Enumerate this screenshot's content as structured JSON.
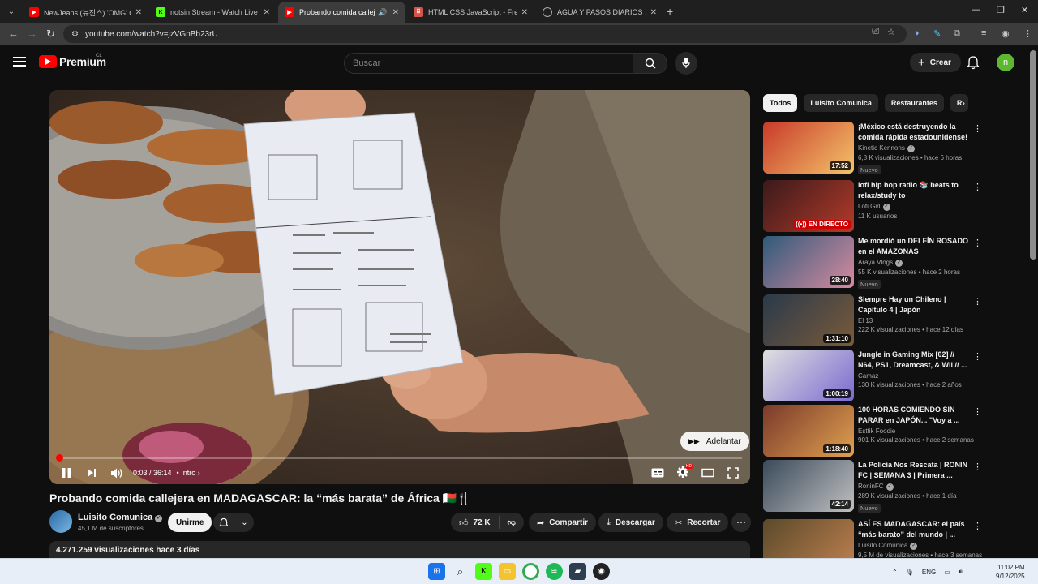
{
  "browser": {
    "tabs": [
      {
        "title": "NewJeans (뉴진스) 'OMG' Offic",
        "active": false,
        "favicon_color": "#ff0000"
      },
      {
        "title": "notsin Stream - Watch Live on",
        "active": false,
        "favicon_color": "#53fc18"
      },
      {
        "title": "Probando comida callejera",
        "active": true,
        "favicon_color": "#ff0000"
      },
      {
        "title": "HTML CSS JavaScript - Free Onl",
        "active": false,
        "favicon_color": "#d4534a"
      },
      {
        "title": "AGUA Y PASOS DIARIOS 💦🏃",
        "active": false,
        "favicon_color": "#aaaaaa"
      }
    ],
    "url": "youtube.com/watch?v=jzVGnBb23rU"
  },
  "header": {
    "logo_text": "Premium",
    "country": "CL",
    "search_placeholder": "Buscar",
    "create_label": "Crear",
    "avatar_letter": "n"
  },
  "player": {
    "skip_label": "Adelantar",
    "time": "0:03 / 36:14",
    "chapter": "Intro",
    "progress": 0.0014
  },
  "video": {
    "title": "Probando comida callejera en MADAGASCAR: la “más barata” de África 🇲🇬🍴",
    "channel": "Luisito Comunica",
    "subscribers": "45,1 M de suscriptores",
    "join_label": "Unirme",
    "likes": "72 K",
    "share_label": "Compartir",
    "download_label": "Descargar",
    "clip_label": "Recortar",
    "views_line": "4.271.259 visualizaciones  hace 3 días"
  },
  "sidebar": {
    "chips": [
      "Todos",
      "Luisito Comunica",
      "Restaurantes",
      "R"
    ],
    "recs": [
      {
        "title": "¡México está destruyendo la comida rápida estadounidense!",
        "channel": "Kinetic Kennons",
        "verified": true,
        "meta": "6,8 K visualizaciones • hace 6 horas",
        "badge": "Nuevo",
        "duration": "17:52",
        "live": false
      },
      {
        "title": "lofi hip hop radio 📚 beats to relax/study to",
        "channel": "Lofi Girl",
        "verified": true,
        "meta": "11 K usuarios",
        "badge": "",
        "duration": "EN DIRECTO",
        "live": true
      },
      {
        "title": "Me mordió un DELFÍN ROSADO en el AMAZONAS",
        "channel": "Araya Vlogs",
        "verified": true,
        "meta": "55 K visualizaciones • hace 2 horas",
        "badge": "Nuevo",
        "duration": "28:40",
        "live": false
      },
      {
        "title": "Siempre Hay un Chileno | Capítulo 4 | Japón",
        "channel": "El 13",
        "verified": false,
        "meta": "222 K visualizaciones • hace 12 días",
        "badge": "",
        "duration": "1:31:10",
        "live": false
      },
      {
        "title": "Jungle in Gaming Mix [02] // N64, PS1, Dreamcast, & Wii // ...",
        "channel": "Camaz",
        "verified": false,
        "meta": "130 K visualizaciones • hace 2 años",
        "badge": "",
        "duration": "1:00:19",
        "live": false
      },
      {
        "title": "100 HORAS COMIENDO SIN PARAR en JAPÓN... \"Voy a ...",
        "channel": "Esttik Foodie",
        "verified": false,
        "meta": "901 K visualizaciones • hace 2 semanas",
        "badge": "",
        "duration": "1:18:40",
        "live": false
      },
      {
        "title": "La Policía Nos Rescata | RONIN FC | SEMANA 3 | Primera ...",
        "channel": "RoninFC",
        "verified": true,
        "meta": "289 K visualizaciones • hace 1 día",
        "badge": "Nuevo",
        "duration": "42:14",
        "live": false
      },
      {
        "title": "ASÍ ES MADAGASCAR: el país “más barato” del mundo | ...",
        "channel": "Luisito Comunica",
        "verified": true,
        "meta": "9,5 M de visualizaciones • hace 3 semanas",
        "badge": "",
        "duration": "",
        "live": false
      }
    ]
  },
  "taskbar": {
    "lang": "ENG",
    "time": "11:02 PM",
    "date": "9/12/2025"
  }
}
